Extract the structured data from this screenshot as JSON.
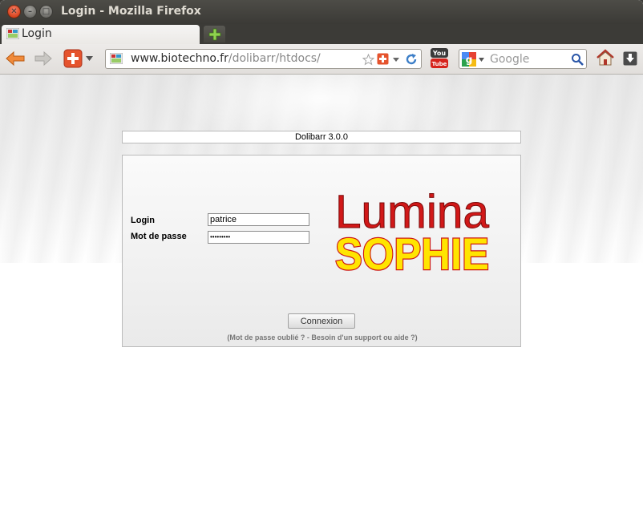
{
  "window": {
    "title": "Login - Mozilla Firefox"
  },
  "tabs": [
    {
      "label": "Login",
      "active": true
    }
  ],
  "navbar": {
    "url_domain": "www.biotechno.fr",
    "url_path": "/dolibarr/htdocs/",
    "search_placeholder": "Google"
  },
  "page": {
    "version": "Dolibarr 3.0.0",
    "login_label": "Login",
    "login_value": "patrice",
    "password_label": "Mot de passe",
    "password_value": "•••••••••",
    "submit_label": "Connexion",
    "help_text": "(Mot de passe oublié ? - Besoin d'un support ou aide ?)",
    "logo_line1": "Lumina",
    "logo_line2": "SOPHIE"
  },
  "colors": {
    "accent_close": "#d9441e",
    "logo_red": "#cc1616",
    "logo_yellow": "#ffe800"
  }
}
